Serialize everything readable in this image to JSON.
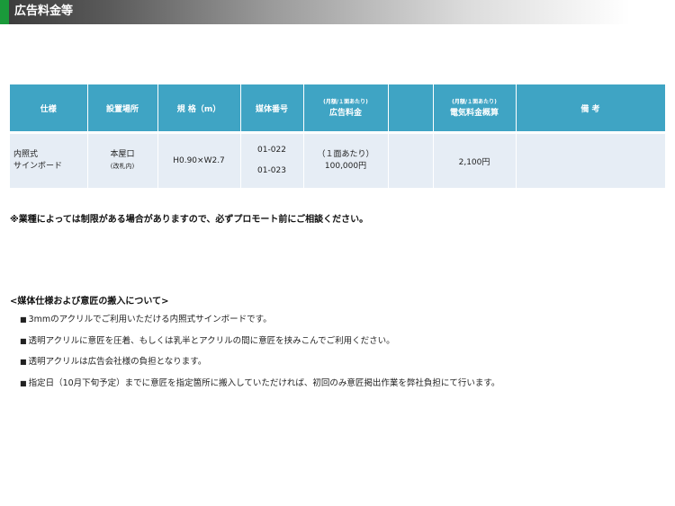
{
  "header": {
    "title": "広告料金等"
  },
  "table": {
    "headers": {
      "spec": "仕様",
      "location": "設置場所",
      "size": "規 格（m）",
      "media_no": "媒体番号",
      "price_sub": "(月額/１面あたり)",
      "price": "広告料金",
      "elec_sub": "(月額/１面あたり)",
      "elec": "電気料金概算",
      "remarks": "備 考"
    },
    "row": {
      "spec_line1": "内照式",
      "spec_line2": "サインボード",
      "location_line1": "本屋口",
      "location_line2": "(改札内)",
      "size": "H0.90×W2.7",
      "media_no_1": "01-022",
      "media_no_2": "01-023",
      "price_line1": "（１面あたり）",
      "price_line2": "100,000円",
      "elec": "2,100円",
      "remarks": ""
    }
  },
  "note": "※業種によっては制限がある場合がありますので、必ずプロモート前にご相談ください。",
  "section": {
    "title": "<媒体仕様および意匠の搬入について>",
    "bullet_symbol": "■",
    "items": [
      "3mmのアクリルでご利用いただける内照式サインボードです。",
      "透明アクリルに意匠を圧着、もしくは乳半とアクリルの間に意匠を挟みこんでご利用ください。",
      "透明アクリルは広告会社様の負担となります。",
      "指定日（10月下旬予定）までに意匠を指定箇所に搬入していただければ、初回のみ意匠掲出作業を弊社負担にて行います。"
    ]
  }
}
